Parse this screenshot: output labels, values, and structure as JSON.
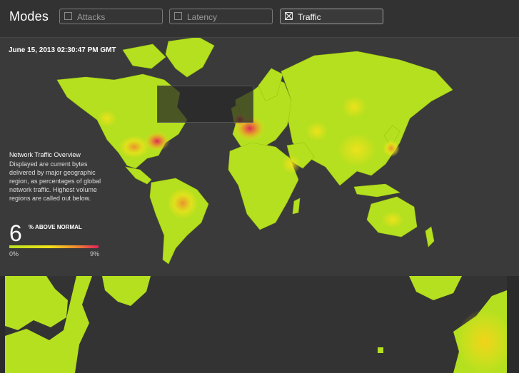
{
  "header": {
    "title": "Modes",
    "modes": [
      {
        "label": "Attacks",
        "checked": false
      },
      {
        "label": "Latency",
        "checked": false
      },
      {
        "label": "Traffic",
        "checked": true
      }
    ]
  },
  "map": {
    "timestamp": "June 15, 2013 02:30:47 PM GMT"
  },
  "legend": {
    "title": "Network Traffic Overview",
    "description": "Displayed are current bytes delivered by major geographic region, as percentages of global network traffic. Highest volume regions are called out below.",
    "value": "6",
    "value_label": "% ABOVE NORMAL",
    "scale_min": "0%",
    "scale_max": "9%"
  },
  "colors": {
    "land": "#b4e01f",
    "hot_low": "#f2e21a",
    "hot_mid": "#f08a30",
    "hot_high": "#e0205a",
    "background": "#2b2b2b"
  }
}
